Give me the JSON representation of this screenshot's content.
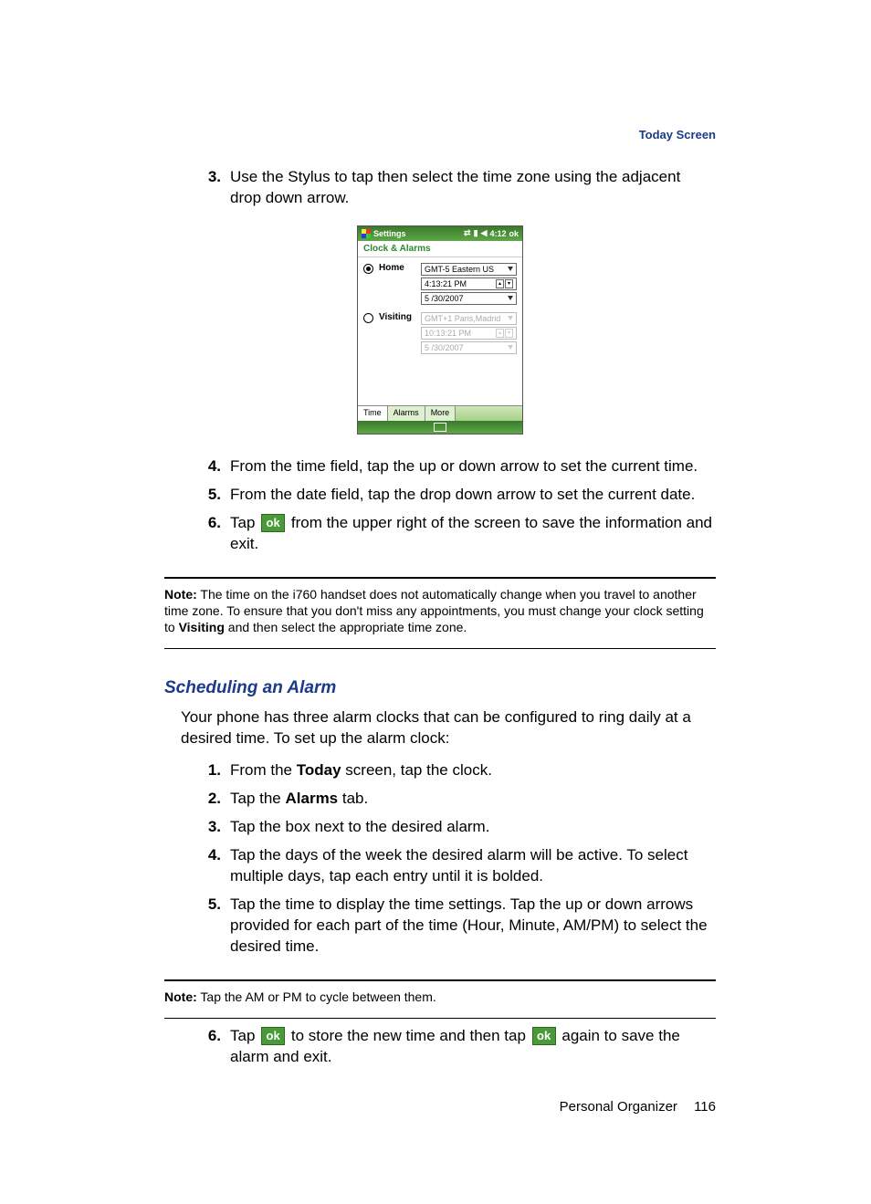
{
  "header": {
    "section_title": "Today Screen"
  },
  "stepsA": {
    "s3": {
      "num": "3.",
      "text": "Use the Stylus to tap then select the time zone using the adjacent drop down arrow."
    },
    "s4": {
      "num": "4.",
      "text": "From the time field, tap the up or down arrow to set the current time."
    },
    "s5": {
      "num": "5.",
      "text": "From the date field, tap the drop down arrow to set the current date."
    },
    "s6": {
      "num": "6.",
      "text_a": "Tap ",
      "text_b": " from the upper right of the screen to save the information and exit."
    }
  },
  "ok_label": "ok",
  "phone": {
    "title_bar": "Settings",
    "status_time": "4:12",
    "status_ok": "ok",
    "section": "Clock & Alarms",
    "home_label": "Home",
    "visiting_label": "Visiting",
    "home_tz": "GMT-5 Eastern US",
    "home_time": "4:13:21 PM",
    "home_date": "5 /30/2007",
    "visit_tz": "GMT+1 Paris,Madrid",
    "visit_time": "10:13:21 PM",
    "visit_date": "5 /30/2007",
    "tabs": {
      "time": "Time",
      "alarms": "Alarms",
      "more": "More"
    }
  },
  "note1": {
    "label": "Note:",
    "text_a": " The time on the i760 handset does not automatically change when you travel to another time zone. To ensure that you don't miss any appointments, you must change your clock setting to ",
    "bold": "Visiting",
    "text_b": " and then select the appropriate time zone."
  },
  "subheading": "Scheduling an Alarm",
  "intro": "Your phone has three alarm clocks that can be configured to ring daily at a desired time. To set up the alarm clock:",
  "stepsB": {
    "s1": {
      "num": "1.",
      "text_a": "From the ",
      "bold": "Today",
      "text_b": " screen, tap the clock."
    },
    "s2": {
      "num": "2.",
      "text_a": "Tap the ",
      "bold": "Alarms",
      "text_b": " tab."
    },
    "s3": {
      "num": "3.",
      "text": "Tap the box next to the desired alarm."
    },
    "s4": {
      "num": "4.",
      "text": "Tap the days of the week the desired alarm will be active. To select multiple days, tap each entry until it is bolded."
    },
    "s5": {
      "num": "5.",
      "text": "Tap the time to display the time settings. Tap the up or down arrows provided for each part of the time (Hour, Minute, AM/PM) to select the desired time."
    },
    "s6": {
      "num": "6.",
      "text_a": "Tap ",
      "text_b": " to store the new time and then tap ",
      "text_c": " again to save the alarm and exit."
    }
  },
  "note2": {
    "label": "Note:",
    "text": " Tap the AM or PM to cycle between them."
  },
  "footer": {
    "chapter": "Personal Organizer",
    "page": "116"
  }
}
